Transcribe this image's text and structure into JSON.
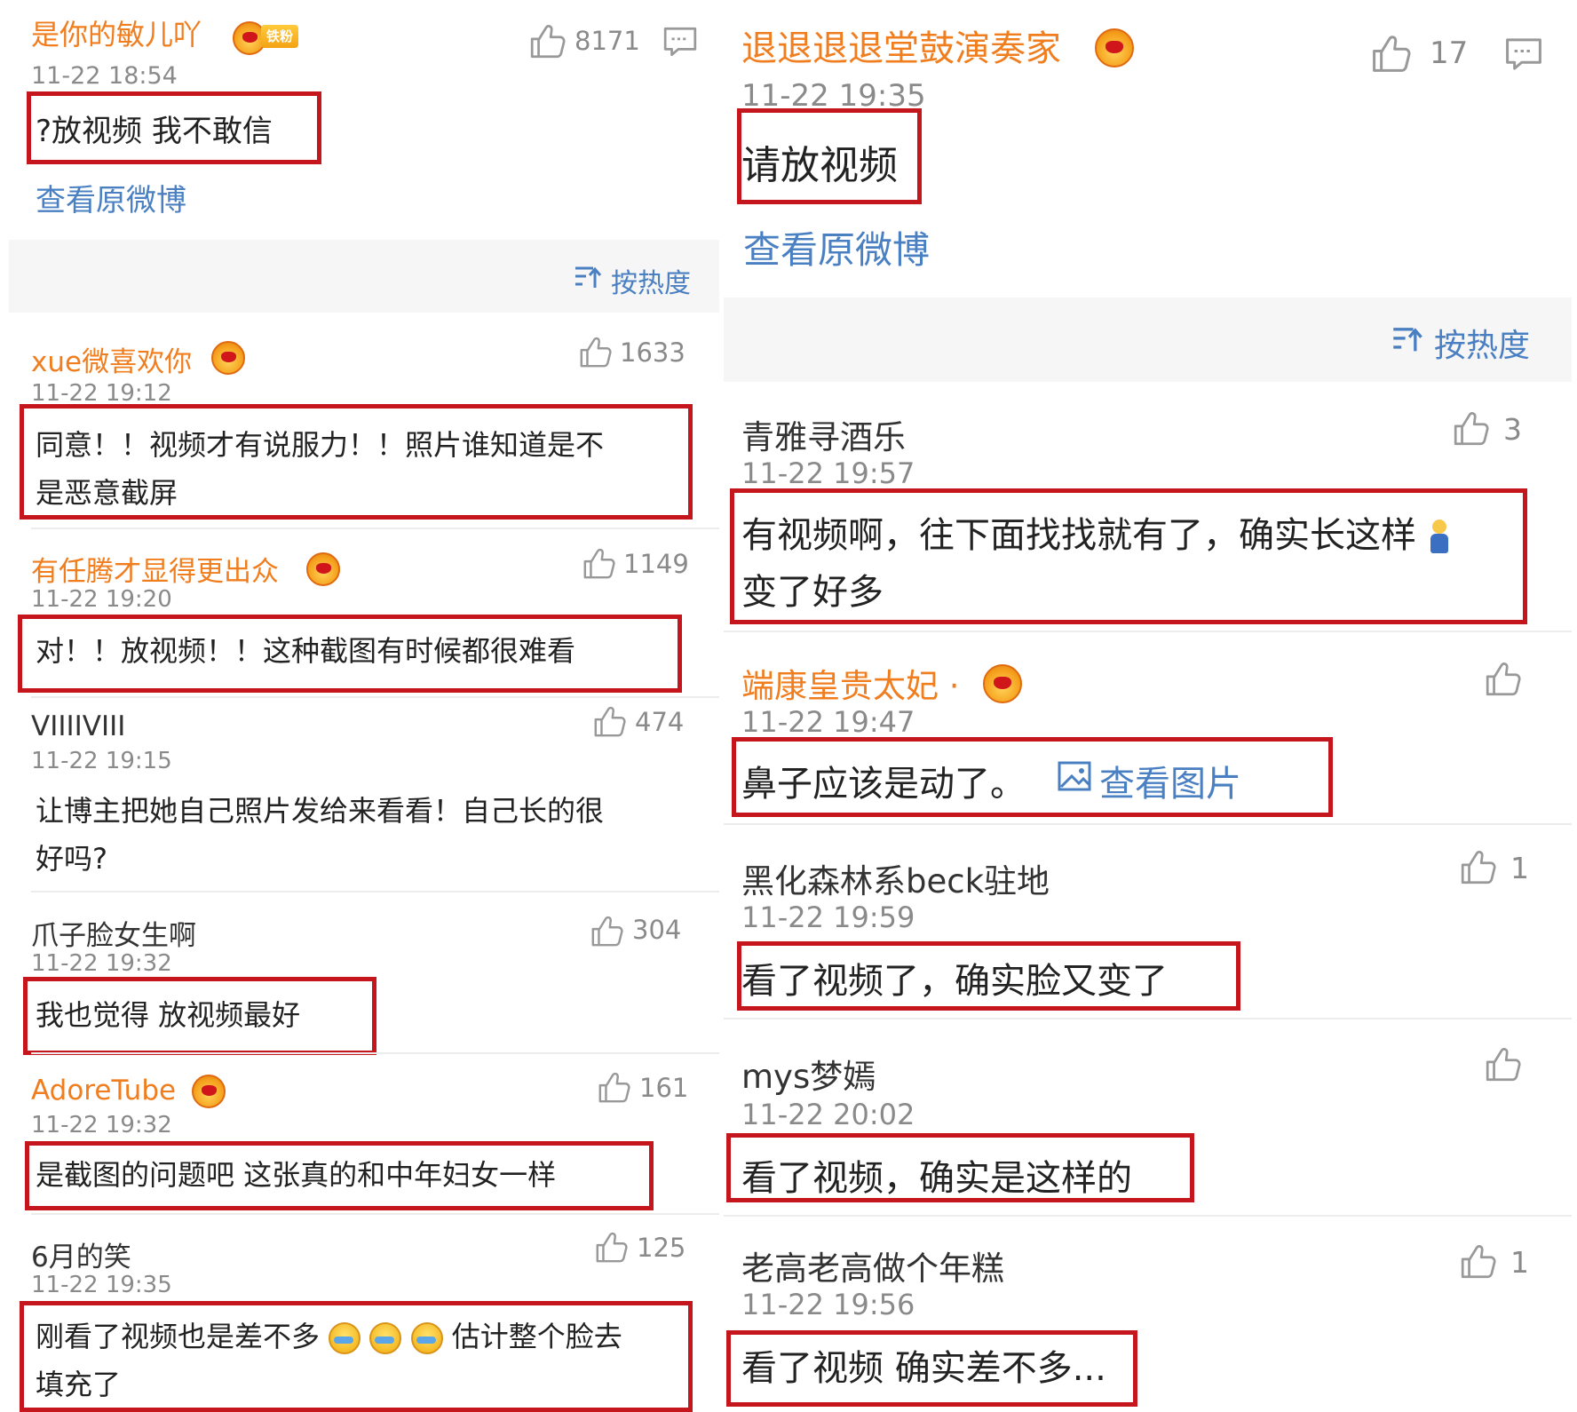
{
  "left": {
    "post": {
      "username": "是你的敏儿吖",
      "fan_badge": "铁粉",
      "likes": "8171",
      "time": "11-22 18:54",
      "text": "?放视频 我不敢信",
      "view_link": "查看原微博"
    },
    "sort_label": "按热度",
    "comments": [
      {
        "name": "xue微喜欢你",
        "time": "11-22 19:12",
        "likes": "1633",
        "line1": "同意！！视频才有说服力！！照片谁知道是不",
        "line2": "是恶意截屏"
      },
      {
        "name": "有任腾才显得更出众",
        "time": "11-22 19:20",
        "likes": "1149",
        "line1": "对！！放视频！！这种截图有时候都很难看"
      },
      {
        "name": "VIIIIVIII",
        "time": "11-22 19:15",
        "likes": "474",
        "line1": "让博主把她自己照片发给来看看！自己长的很",
        "line2": "好吗?"
      },
      {
        "name": "爪子脸女生啊",
        "time": "11-22 19:32",
        "likes": "304",
        "line1": "我也觉得 放视频最好"
      },
      {
        "name": "AdoreTube",
        "time": "11-22 19:32",
        "likes": "161",
        "line1": "是截图的问题吧 这张真的和中年妇女一样"
      },
      {
        "name": "6月的笑",
        "time": "11-22 19:35",
        "likes": "125",
        "line1a": "刚看了视频也是差不多",
        "line1b": "估计整个脸去",
        "line2": "填充了"
      }
    ]
  },
  "right": {
    "post": {
      "username": "退退退退堂鼓演奏家",
      "likes": "17",
      "time": "11-22 19:35",
      "text": "请放视频",
      "view_link": "查看原微博"
    },
    "sort_label": "按热度",
    "comments": [
      {
        "name": "青雅寻酒乐",
        "time": "11-22 19:57",
        "likes": "3",
        "line1": "有视频啊，往下面找找就有了，确实长这样",
        "line2": "变了好多"
      },
      {
        "name": "端康皇贵太妃 ·",
        "time": "11-22 19:47",
        "likes": "",
        "line1": "鼻子应该是动了。",
        "image_link": "查看图片"
      },
      {
        "name": "黑化森林系beck驻地",
        "time": "11-22 19:59",
        "likes": "1",
        "line1": "看了视频了，确实脸又变了"
      },
      {
        "name": "mys梦嫣",
        "time": "11-22 20:02",
        "likes": "",
        "line1": "看了视频，确实是这样的"
      },
      {
        "name": "老高老高做个年糕",
        "time": "11-22 19:56",
        "likes": "1",
        "line1": "看了视频 确实差不多..."
      }
    ]
  },
  "icons": {
    "like": "thumbs-up-icon",
    "comment": "comment-bubble-icon",
    "sort": "sort-icon",
    "image": "image-icon",
    "crown": "crown-badge-icon"
  },
  "colors": {
    "highlight_box": "#c4161c",
    "username_vip": "#f07d1e",
    "link": "#4a80c2"
  }
}
